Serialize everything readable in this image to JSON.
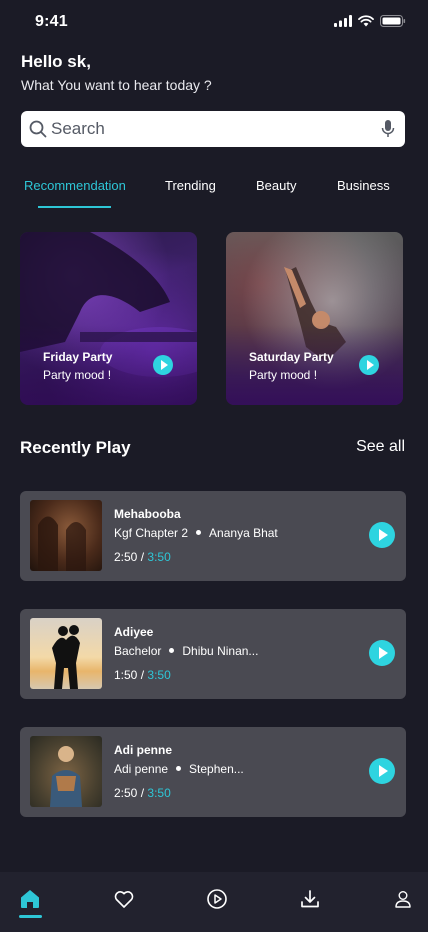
{
  "status": {
    "time": "9:41"
  },
  "header": {
    "greeting": "Hello sk,",
    "subtitle": "What You want to hear today ?"
  },
  "search": {
    "placeholder": "Search"
  },
  "tabs": [
    {
      "label": "Recommendation",
      "active": true
    },
    {
      "label": "Trending",
      "active": false
    },
    {
      "label": "Beauty",
      "active": false
    },
    {
      "label": "Business",
      "active": false
    }
  ],
  "featured": [
    {
      "title": "Friday Party",
      "subtitle": "Party mood !"
    },
    {
      "title": "Saturday Party",
      "subtitle": "Party mood !"
    }
  ],
  "recent": {
    "title": "Recently Play",
    "see_all": "See all",
    "items": [
      {
        "title": "Mehabooba",
        "album": "Kgf Chapter 2",
        "artist": "Ananya Bhat",
        "elapsed": "2:50",
        "separator": "/",
        "duration": "3:50"
      },
      {
        "title": "Adiyee",
        "album": "Bachelor",
        "artist": "Dhibu Ninan...",
        "elapsed": "1:50",
        "separator": "/",
        "duration": "3:50"
      },
      {
        "title": "Adi penne",
        "album": "Adi penne",
        "artist": "Stephen...",
        "elapsed": "2:50",
        "separator": "/",
        "duration": "3:50"
      }
    ]
  },
  "nav": {
    "items": [
      "home-icon",
      "heart-icon",
      "play-circle-icon",
      "download-icon",
      "user-icon"
    ],
    "active": "home-icon"
  },
  "colors": {
    "background": "#1b1b26",
    "accent": "#2ec6d6",
    "card": "#4a4a52",
    "nav": "#22222e"
  }
}
